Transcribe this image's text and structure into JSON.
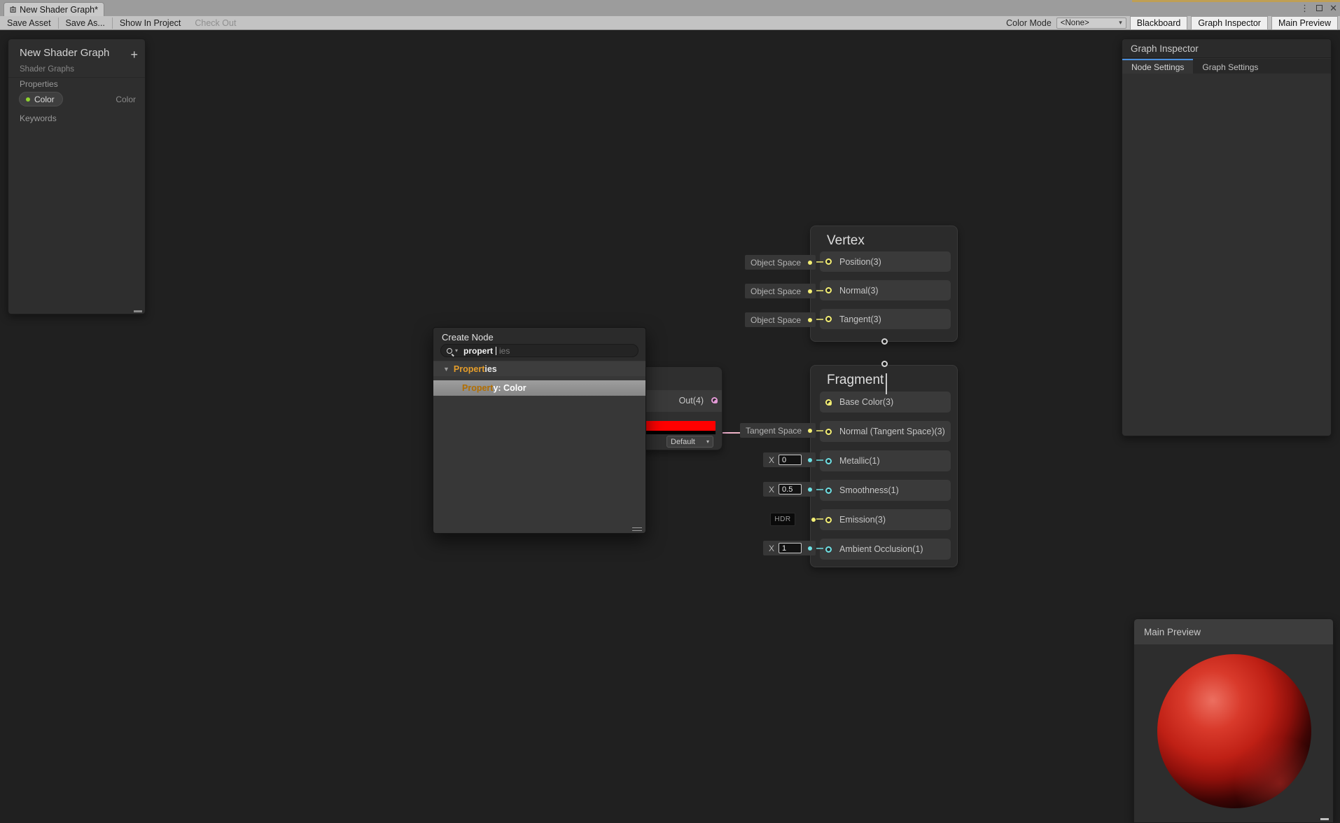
{
  "window": {
    "tab_title": "New Shader Graph*",
    "menu_glyph": "⋮",
    "close_glyph": "✕"
  },
  "toolbar": {
    "save_asset": "Save Asset",
    "save_as": "Save As...",
    "show_in_project": "Show In Project",
    "check_out": "Check Out",
    "color_mode_label": "Color Mode",
    "color_mode_value": "<None>",
    "blackboard": "Blackboard",
    "graph_inspector": "Graph Inspector",
    "main_preview": "Main Preview",
    "chevron": "▾"
  },
  "blackboard": {
    "title": "New Shader Graph",
    "subtitle": "Shader Graphs",
    "add_label": "+",
    "properties_label": "Properties",
    "keywords_label": "Keywords",
    "property": {
      "name": "Color",
      "type": "Color"
    }
  },
  "inspector": {
    "title": "Graph Inspector",
    "tab_node_settings": "Node Settings",
    "tab_graph_settings": "Graph Settings"
  },
  "create_node": {
    "title": "Create Node",
    "search_text": "propert",
    "search_ghost": "ies",
    "chevron": "▾",
    "triangle": "▼",
    "category": {
      "prefix": "Propert",
      "suffix": "ies"
    },
    "result": {
      "prefix": "Propert",
      "suffix": "y: Color"
    }
  },
  "color_node": {
    "out_label": "Out(4)",
    "swatch_color": "#ff0000",
    "dropdown_label": "Default",
    "chevron": "▾"
  },
  "vertex_node": {
    "title": "Vertex",
    "rows": [
      {
        "label": "Position(3)",
        "space": "Object Space"
      },
      {
        "label": "Normal(3)",
        "space": "Object Space"
      },
      {
        "label": "Tangent(3)",
        "space": "Object Space"
      }
    ]
  },
  "fragment_node": {
    "title": "Fragment",
    "rows": [
      {
        "label": "Base Color(3)"
      },
      {
        "label": "Normal (Tangent Space)(3)",
        "space": "Tangent Space"
      },
      {
        "label": "Metallic(1)",
        "prefix": "X",
        "value": "0"
      },
      {
        "label": "Smoothness(1)",
        "prefix": "X",
        "value": "0.5"
      },
      {
        "label": "Emission(3)",
        "hdr": "HDR"
      },
      {
        "label": "Ambient Occlusion(1)",
        "prefix": "X",
        "value": "1"
      }
    ]
  },
  "preview": {
    "title": "Main Preview"
  },
  "colors": {
    "port_yellow": "#f4ef74",
    "port_cyan": "#6ee0e4",
    "port_pink": "#e59ad8",
    "wire_pink": "#f0abd3",
    "wire_yellow": "#e7e285",
    "highlight_orange": "#e59d2a",
    "tab_accent_blue": "#4a8fdd",
    "exposed_dot_green": "#8ed22e",
    "swatch_red": "#ff0000"
  }
}
